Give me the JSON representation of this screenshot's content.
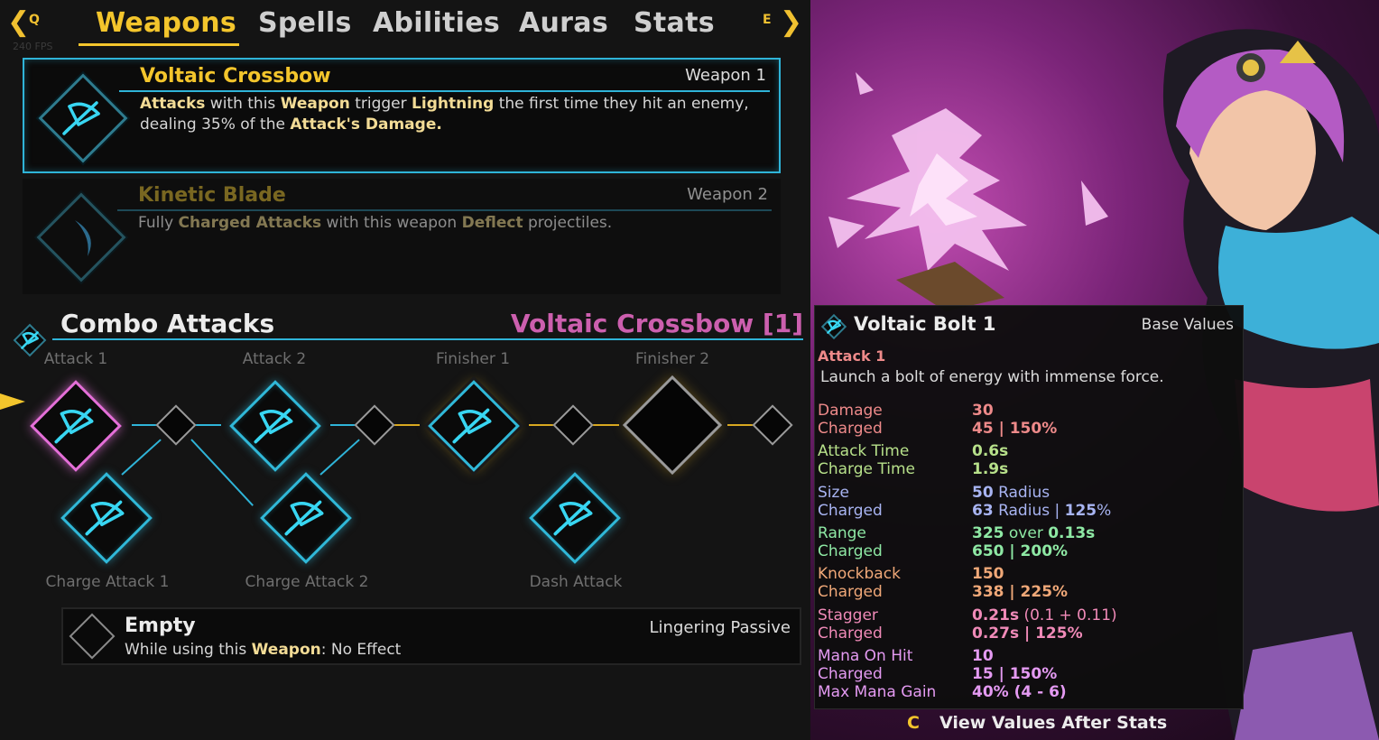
{
  "nav": {
    "prev_key": "Q",
    "next_key": "E",
    "fps": "240 FPS",
    "tabs": [
      {
        "label": "Weapons",
        "active": true
      },
      {
        "label": "Spells",
        "active": false
      },
      {
        "label": "Abilities",
        "active": false
      },
      {
        "label": "Auras",
        "active": false
      },
      {
        "label": "Stats",
        "active": false
      }
    ]
  },
  "weapons": [
    {
      "name": "Voltaic Crossbow",
      "slot": "Weapon 1",
      "desc_parts": [
        {
          "t": "Attacks",
          "hl": true
        },
        {
          "t": " with this ",
          "hl": false
        },
        {
          "t": "Weapon",
          "hl": true
        },
        {
          "t": " trigger ",
          "hl": false
        },
        {
          "t": "Lightning",
          "hl": true
        },
        {
          "t": " the first time they hit an enemy, dealing 35% of the ",
          "hl": false
        },
        {
          "t": "Attack's Damage.",
          "hl": true
        }
      ],
      "icon": "crossbow-icon"
    },
    {
      "name": "Kinetic Blade",
      "slot": "Weapon 2",
      "desc_parts": [
        {
          "t": "Fully ",
          "hl": false
        },
        {
          "t": "Charged Attacks",
          "hl": true
        },
        {
          "t": " with this weapon ",
          "hl": false
        },
        {
          "t": "Deflect",
          "hl": true
        },
        {
          "t": " projectiles.",
          "hl": false
        }
      ],
      "icon": "crescent-blade-icon"
    }
  ],
  "combo": {
    "title": "Combo Attacks",
    "weapon_label": "Voltaic Crossbow [1]",
    "slots": {
      "attack1": "Attack 1",
      "attack2": "Attack 2",
      "finisher1": "Finisher 1",
      "finisher2": "Finisher 2",
      "charge1": "Charge Attack 1",
      "charge2": "Charge Attack 2",
      "dash": "Dash Attack"
    }
  },
  "passive": {
    "title": "Empty",
    "prefix": "While using this ",
    "weapon_word": "Weapon",
    "suffix": ": No Effect",
    "type": "Lingering Passive"
  },
  "tooltip": {
    "title": "Voltaic Bolt 1",
    "mode": "Base Values",
    "attack_label": "Attack 1",
    "description": "Launch a bolt of energy with immense force.",
    "stats": [
      {
        "label": "Damage",
        "parts": [
          {
            "t": "30",
            "b": true
          }
        ],
        "color": "#ee8a8a"
      },
      {
        "label": "Charged",
        "parts": [
          {
            "t": "45 | 150%",
            "b": true
          }
        ],
        "color": "#ee8a8a"
      },
      {
        "label": "Attack Time",
        "parts": [
          {
            "t": "0.6s",
            "b": true
          }
        ],
        "color": "#b7e08a"
      },
      {
        "label": "Charge Time",
        "parts": [
          {
            "t": "1.9s",
            "b": true
          }
        ],
        "color": "#b7e08a"
      },
      {
        "label": "Size",
        "parts": [
          {
            "t": "50",
            "b": true
          },
          {
            "t": " Radius",
            "b": false
          }
        ],
        "color": "#a8b4f2"
      },
      {
        "label": "Charged",
        "parts": [
          {
            "t": "63",
            "b": true
          },
          {
            "t": " Radius | ",
            "b": false
          },
          {
            "t": "125",
            "b": true
          },
          {
            "t": "%",
            "b": false
          }
        ],
        "color": "#a8b4f2"
      },
      {
        "label": "Range",
        "parts": [
          {
            "t": "325",
            "b": true
          },
          {
            "t": " over ",
            "b": false
          },
          {
            "t": "0.13s",
            "b": true
          }
        ],
        "color": "#8ee8a4"
      },
      {
        "label": "Charged",
        "parts": [
          {
            "t": "650 | 200%",
            "b": true
          }
        ],
        "color": "#8ee8a4"
      },
      {
        "label": "Knockback",
        "parts": [
          {
            "t": "150",
            "b": true
          }
        ],
        "color": "#f0a878"
      },
      {
        "label": "Charged",
        "parts": [
          {
            "t": "338 | 225%",
            "b": true
          }
        ],
        "color": "#f0a878"
      },
      {
        "label": "Stagger",
        "parts": [
          {
            "t": "0.21s",
            "b": true
          },
          {
            "t": " (0.1 + 0.11)",
            "b": false
          }
        ],
        "color": "#f08ab8"
      },
      {
        "label": "Charged",
        "parts": [
          {
            "t": "0.27s | 125%",
            "b": true
          }
        ],
        "color": "#f08ab8"
      },
      {
        "label": "Mana On Hit",
        "parts": [
          {
            "t": "10",
            "b": true
          }
        ],
        "color": "#e49af2"
      },
      {
        "label": "Charged",
        "parts": [
          {
            "t": "15 | 150%",
            "b": true
          }
        ],
        "color": "#e49af2"
      },
      {
        "label": "Max Mana Gain",
        "parts": [
          {
            "t": "40% (4 - 6)",
            "b": true
          }
        ],
        "color": "#e49af2"
      }
    ]
  },
  "footer": {
    "key": "C",
    "label": "View Values After Stats"
  },
  "colors": {
    "accent_gold": "#f3c52c",
    "accent_cyan": "#2fb4d8",
    "accent_pink": "#cc5fae"
  }
}
